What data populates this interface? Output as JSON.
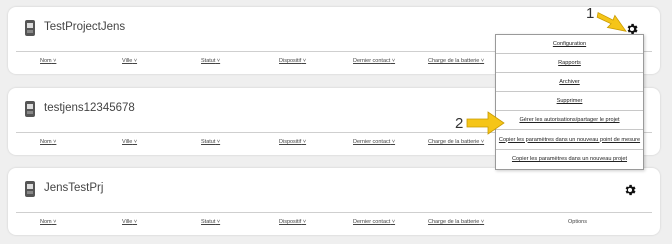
{
  "projects": [
    {
      "name": "TestProjectJens"
    },
    {
      "name": "testjens12345678"
    },
    {
      "name": "JensTestPrj"
    }
  ],
  "columns": {
    "nom": "Nom",
    "ville": "Ville",
    "statut": "Statut",
    "dispositif": "Dispositif",
    "dernier_contact": "Dernier contact",
    "charge": "Charge de la batterie",
    "options": "Options"
  },
  "menu": {
    "items": [
      "Configuration",
      "Rapports",
      "Archiver",
      "Supprimer",
      "Gérer les autorisations/partager le projet",
      "Copier les paramètres dans un nouveau point de mesure",
      "Copier les paramètres dans un nouveau projet"
    ]
  },
  "annotations": {
    "step1": "1",
    "step2": "2",
    "arrow_color": "#f5c518"
  },
  "icons": {
    "device": "device-icon",
    "settings": "gear-icon"
  }
}
